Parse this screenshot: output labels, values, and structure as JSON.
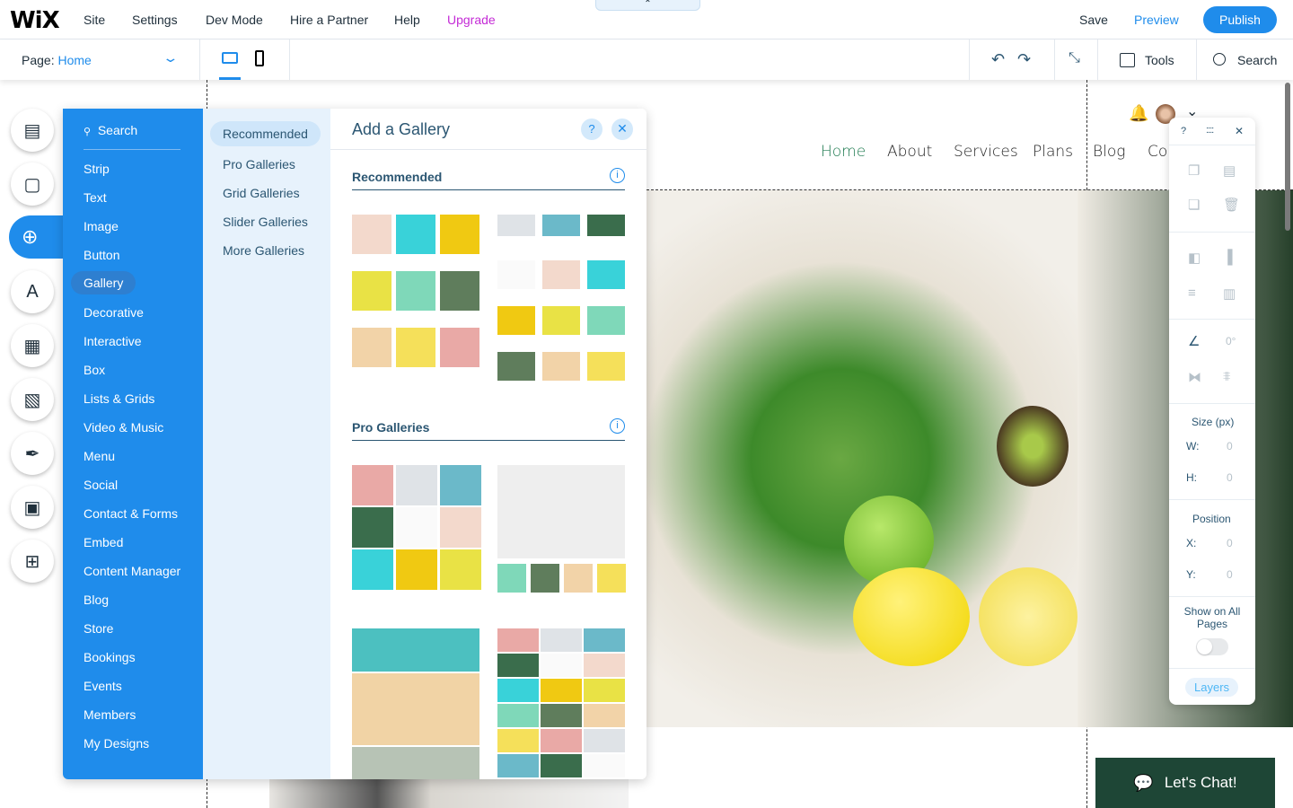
{
  "topbar": {
    "logo": "WiX",
    "menu": [
      "Site",
      "Settings",
      "Dev Mode",
      "Hire a Partner",
      "Help",
      "Upgrade"
    ],
    "save": "Save",
    "preview": "Preview",
    "publish": "Publish",
    "collapse_icon": "chevron-up-icon"
  },
  "subbar": {
    "page_label": "Page:",
    "page_value": "Home",
    "tools": "Tools",
    "search": "Search"
  },
  "left_tools": [
    "pages-icon",
    "background-icon",
    "add-icon",
    "theme-icon",
    "apps-icon",
    "media-icon",
    "pen-icon",
    "bookings-icon",
    "portfolio-icon"
  ],
  "add_panel": {
    "search": "Search",
    "categories": [
      "Strip",
      "Text",
      "Image",
      "Button",
      "Gallery",
      "Decorative",
      "Interactive",
      "Box",
      "Lists & Grids",
      "Video & Music",
      "Menu",
      "Social",
      "Contact & Forms",
      "Embed",
      "Content Manager",
      "Blog",
      "Store",
      "Bookings",
      "Events",
      "Members",
      "My Designs"
    ],
    "selected_category": "Gallery",
    "subcategories": [
      "Recommended",
      "Pro Galleries",
      "Grid Galleries",
      "Slider Galleries",
      "More Galleries"
    ],
    "title": "Add a Gallery",
    "sections": [
      "Recommended",
      "Pro Galleries"
    ],
    "help": "?"
  },
  "site": {
    "nav": [
      "Home",
      "About",
      "Services",
      "Plans",
      "Blog",
      "Contact"
    ],
    "chat": "Let's Chat!",
    "accent": "#1d7a4f"
  },
  "right_panel": {
    "help": "?",
    "size_label": "Size (px)",
    "w": "W:",
    "h": "H:",
    "w_val": "0",
    "h_val": "0",
    "position_label": "Position",
    "x": "X:",
    "y": "Y:",
    "x_val": "0",
    "y_val": "0",
    "rotation": "0°",
    "show_all": "Show on All Pages",
    "layers": "Layers"
  },
  "colors": {
    "blue": "#1f8ceb",
    "upgrade": "#c42bd6",
    "chat_bg": "#1e4636"
  }
}
